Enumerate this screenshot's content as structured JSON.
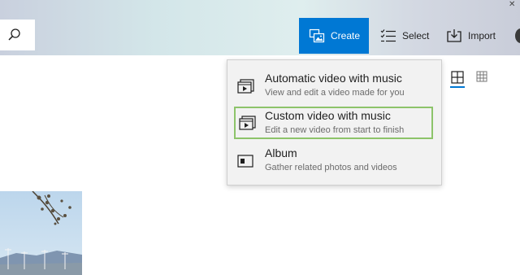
{
  "toolbar": {
    "create_label": "Create",
    "select_label": "Select",
    "import_label": "Import"
  },
  "create_menu": {
    "items": [
      {
        "title": "Automatic video with music",
        "description": "View and edit a video made for you",
        "icon": "video-music-icon"
      },
      {
        "title": "Custom video with music",
        "description": "Edit a new video from start to finish",
        "icon": "video-music-icon",
        "highlighted": true
      },
      {
        "title": "Album",
        "description": "Gather related photos and videos",
        "icon": "album-icon"
      }
    ]
  },
  "colors": {
    "accent": "#0078d4",
    "highlight_border": "#8dc46a",
    "menu_background": "#f2f2f2"
  }
}
